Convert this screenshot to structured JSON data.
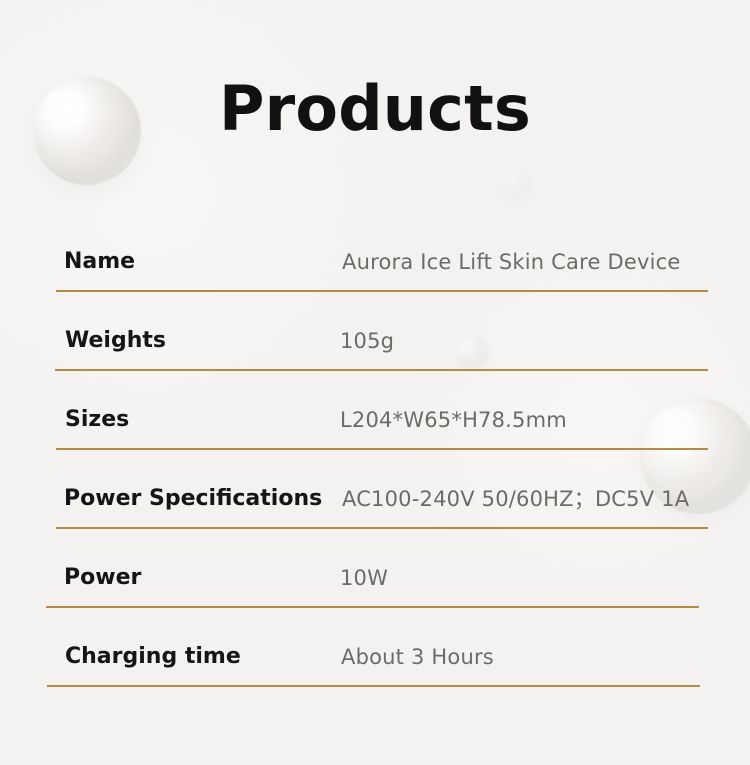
{
  "page": {
    "title": "Products"
  },
  "specs": [
    {
      "label": "Name",
      "value": "Aurora Ice Lift Skin Care Device"
    },
    {
      "label": "Weights",
      "value": "105g"
    },
    {
      "label": "Sizes",
      "value": "L204*W65*H78.5mm"
    },
    {
      "label": "Power Specifications",
      "value": "AC100-240V 50/60HZ；DC5V 1A"
    },
    {
      "label": "Power",
      "value": "10W"
    },
    {
      "label": "Charging time",
      "value": "About 3 Hours"
    }
  ],
  "colors": {
    "background": "#f4f2f0",
    "accent": "#b38b45",
    "label_text": "#151515",
    "value_text": "#6d6a67"
  }
}
